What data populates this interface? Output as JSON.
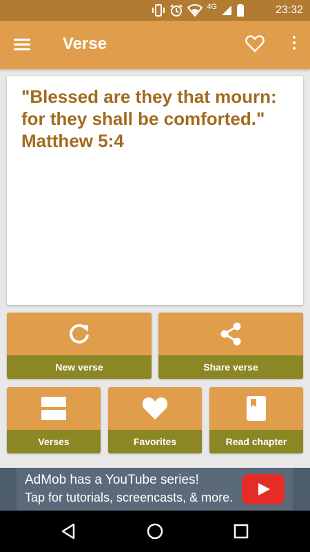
{
  "status_bar": {
    "network": "4G",
    "time": "23:32",
    "icons": [
      "vibrate-icon",
      "alarm-icon",
      "wifi-icon",
      "cell-signal-icon",
      "battery-icon"
    ]
  },
  "toolbar": {
    "title": "Verse",
    "icons": [
      "menu-icon",
      "heart-outline-icon",
      "more-vert-icon"
    ]
  },
  "verse": {
    "text": "\"Blessed are they that mourn: for they shall be comforted.\"",
    "reference": "Matthew 5:4"
  },
  "actions": {
    "new_verse": {
      "label": "New verse",
      "icon": "refresh-icon"
    },
    "share_verse": {
      "label": "Share verse",
      "icon": "share-icon"
    },
    "verses": {
      "label": "Verses",
      "icon": "list-icon"
    },
    "favorites": {
      "label": "Favorites",
      "icon": "heart-icon"
    },
    "read_chapter": {
      "label": "Read chapter",
      "icon": "book-icon"
    }
  },
  "ad": {
    "line1": "AdMob has a YouTube series!",
    "line2": "Tap for tutorials, screencasts, & more.",
    "icon": "youtube-play-icon"
  },
  "nav": {
    "icons": [
      "back-icon",
      "home-icon",
      "recents-icon"
    ]
  },
  "colors": {
    "primary": "#e09d4b",
    "primary_dark": "#b17b32",
    "accent_label": "#8b8725",
    "verse_text": "#a26b1f"
  }
}
